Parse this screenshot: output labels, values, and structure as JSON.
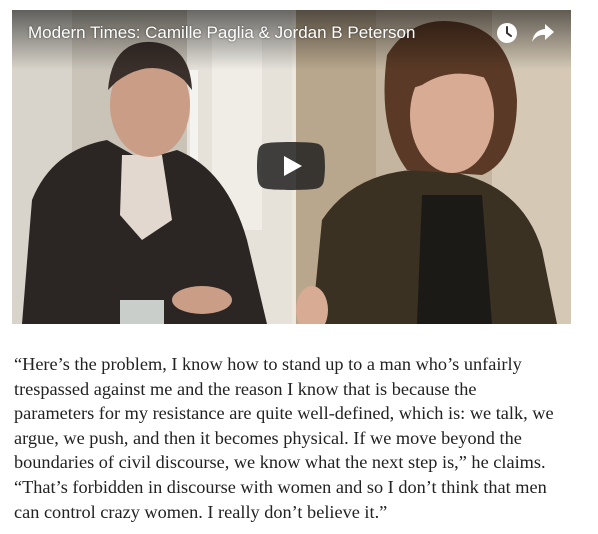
{
  "video": {
    "title": "Modern Times: Camille Paglia & Jordan B Peterson",
    "icons": {
      "watch_later": "clock-icon",
      "share": "share-arrow-icon",
      "play": "play-icon"
    },
    "play_button_color": "#212121"
  },
  "quote": {
    "lines": [
      "“Here’s the problem, I know how to stand up to a man who’s unfairly",
      "trespassed against me and the reason I know that is because the",
      "parameters for my resistance are quite well-defined, which is: we talk, we",
      "argue, we push, and then it becomes physical. If we move beyond the",
      "boundaries of civil discourse, we know what the next step is,” he claims.",
      "“That’s forbidden in discourse with women and so I don’t think that men",
      "can control crazy women. I really don’t believe it.”"
    ]
  }
}
